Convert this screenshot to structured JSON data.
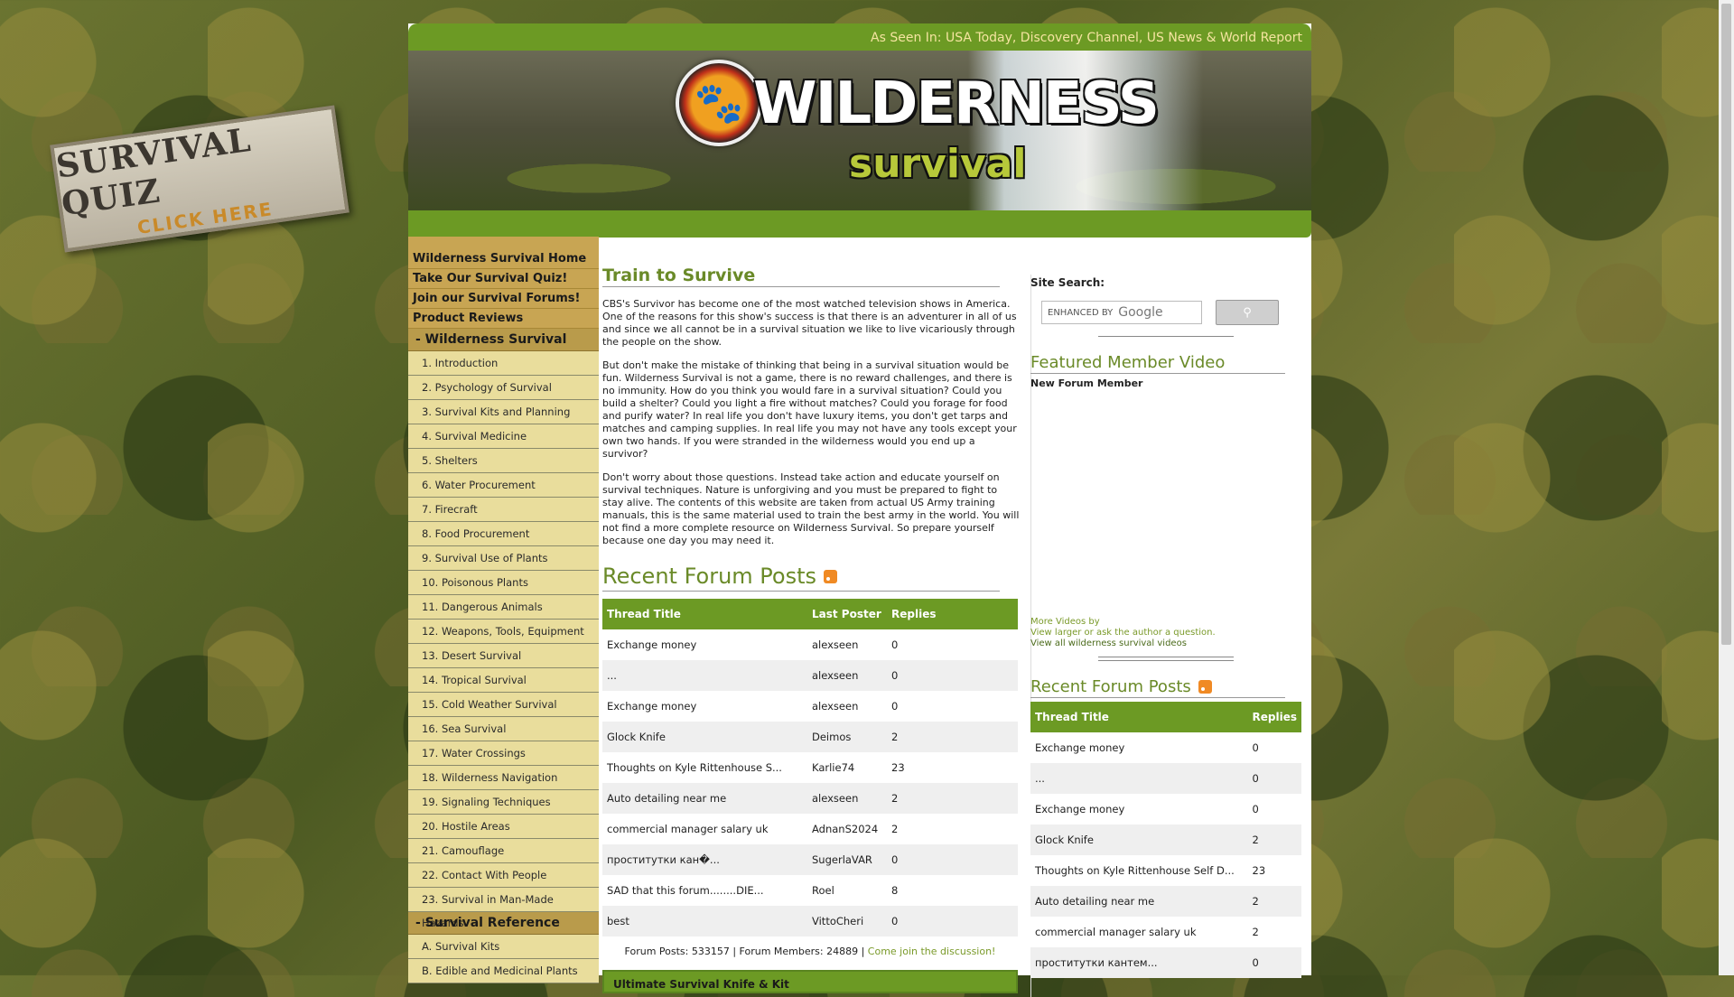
{
  "quiz_badge": {
    "title": "SURVIVAL QUIZ",
    "subtitle": "CLICK HERE"
  },
  "header": {
    "as_seen_in": "As Seen In: USA Today, Discovery Channel, US News & World Report",
    "logo_title": "WILDERNESS",
    "logo_subtitle": "survival"
  },
  "nav": {
    "main": [
      "Wilderness Survival Home",
      "Take Our Survival Quiz!",
      "Join our Survival Forums!",
      "Product Reviews"
    ],
    "section1": "- Wilderness Survival",
    "items1": [
      "1. Introduction",
      "2. Psychology of Survival",
      "3. Survival Kits and Planning",
      "4. Survival Medicine",
      "5. Shelters",
      "6. Water Procurement",
      "7. Firecraft",
      "8. Food Procurement",
      "9. Survival Use of Plants",
      "10. Poisonous Plants",
      "11. Dangerous Animals",
      "12. Weapons, Tools, Equipment",
      "13. Desert Survival",
      "14. Tropical Survival",
      "15. Cold Weather Survival",
      "16. Sea Survival",
      "17. Water Crossings",
      "18. Wilderness Navigation",
      "19. Signaling Techniques",
      "20. Hostile Areas",
      "21. Camouflage",
      "22. Contact With People",
      "23. Survival in Man-Made Hazards"
    ],
    "section2": "- Survival Reference",
    "items2": [
      "A. Survival Kits",
      "B. Edible and Medicinal Plants"
    ]
  },
  "main": {
    "heading": "Train to Survive",
    "paragraphs": [
      "CBS's Survivor has become one of the most watched television shows in America. One of the reasons for this show's success is that there is an adventurer in all of us and since we all cannot be in a survival situation we like to live vicariously through the people on the show.",
      "But don't make the mistake of thinking that being in a survival situation would be fun. Wilderness Survival is not a game, there is no reward challenges, and there is no immunity. How do you think you would fare in a survival situation? Could you build a shelter? Could you light a fire without matches? Could you forage for food and purify water? In real life you don't have luxury items, you don't get tarps and matches and camping supplies. In real life you may not have any tools except your own two hands. If you were stranded in the wilderness would you end up a survivor?",
      "Don't worry about those questions. Instead take action and educate yourself on survival techniques. Nature is unforgiving and you must be prepared to fight to stay alive. The contents of this website are taken from actual US Army training manuals, this is the same material used to train the best army in the world. You will not find a more complete resource on Wilderness Survival. So prepare yourself because one day you may need it."
    ],
    "recent_heading": "Recent Forum Posts",
    "table_headers": {
      "thread": "Thread Title",
      "poster": "Last Poster",
      "replies": "Replies"
    },
    "threads": [
      {
        "title": "Exchange money",
        "poster": "alexseen",
        "replies": "0"
      },
      {
        "title": "...",
        "poster": "alexseen",
        "replies": "0"
      },
      {
        "title": "Exchange money",
        "poster": "alexseen",
        "replies": "0"
      },
      {
        "title": "Glock Knife",
        "poster": "Deimos",
        "replies": "2"
      },
      {
        "title": "Thoughts on Kyle Rittenhouse S...",
        "poster": "Karlie74",
        "replies": "23"
      },
      {
        "title": "Auto detailing near me",
        "poster": "alexseen",
        "replies": "2"
      },
      {
        "title": "commercial manager salary uk",
        "poster": "AdnanS2024",
        "replies": "2"
      },
      {
        "title": "проститутки кан�...",
        "poster": "SugerlaVAR",
        "replies": "0"
      },
      {
        "title": "SAD that this forum........DIE...",
        "poster": "Roel",
        "replies": "8"
      },
      {
        "title": "best",
        "poster": "VittoCheri",
        "replies": "0"
      }
    ],
    "stats_text": "Forum Posts: 533157 | Forum Members: 24889 | ",
    "stats_link": "Come join the discussion!",
    "knife_box": "Ultimate Survival Knife & Kit"
  },
  "right": {
    "search_label": "Site Search:",
    "search_placeholder": "ENHANCED BY",
    "search_brand": "Google",
    "featured_heading": "Featured Member Video",
    "featured_name": "New Forum Member",
    "more_videos": "More Videos by",
    "view_larger": "View larger or ask the author a question.",
    "view_all": "View all wilderness survival videos",
    "recent_heading": "Recent Forum Posts",
    "table_headers": {
      "thread": "Thread Title",
      "replies": "Replies"
    },
    "threads": [
      {
        "title": "Exchange money",
        "replies": "0"
      },
      {
        "title": "...",
        "replies": "0"
      },
      {
        "title": "Exchange money",
        "replies": "0"
      },
      {
        "title": "Glock Knife",
        "replies": "2"
      },
      {
        "title": "Thoughts on Kyle Rittenhouse Self D...",
        "replies": "23"
      },
      {
        "title": "Auto detailing near me",
        "replies": "2"
      },
      {
        "title": "commercial manager salary uk",
        "replies": "2"
      },
      {
        "title": "проститутки кантем...",
        "replies": "0"
      }
    ]
  }
}
